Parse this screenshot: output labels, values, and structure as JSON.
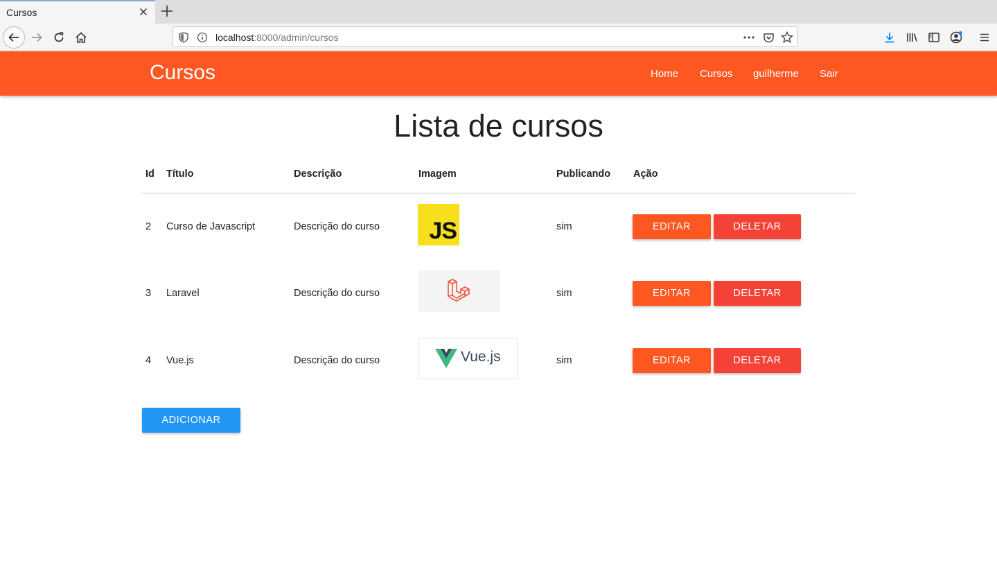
{
  "browser": {
    "tab_title": "Cursos",
    "url_host": "localhost",
    "url_path": ":8000/admin/cursos"
  },
  "app": {
    "brand": "Cursos",
    "nav": [
      "Home",
      "Cursos",
      "guilherme",
      "Sair"
    ],
    "colors": {
      "primary": "#ff5722",
      "danger": "#f44336",
      "accent": "#2196f3"
    }
  },
  "page": {
    "title": "Lista de cursos",
    "headers": [
      "Id",
      "Título",
      "Descrição",
      "Imagem",
      "Publicando",
      "Ação"
    ],
    "rows": [
      {
        "id": "2",
        "titulo": "Curso de Javascript",
        "descricao": "Descrição do curso",
        "imagem": "js-logo",
        "publicando": "sim"
      },
      {
        "id": "3",
        "titulo": "Laravel",
        "descricao": "Descrição do curso",
        "imagem": "laravel-logo",
        "publicando": "sim"
      },
      {
        "id": "4",
        "titulo": "Vue.js",
        "descricao": "Descrição do curso",
        "imagem": "vue-logo",
        "publicando": "sim"
      }
    ],
    "image_labels": {
      "js": "JS",
      "vue": "Vue.js"
    },
    "actions": {
      "edit": "EDITAR",
      "delete": "DELETAR"
    },
    "add_label": "ADICIONAR"
  }
}
